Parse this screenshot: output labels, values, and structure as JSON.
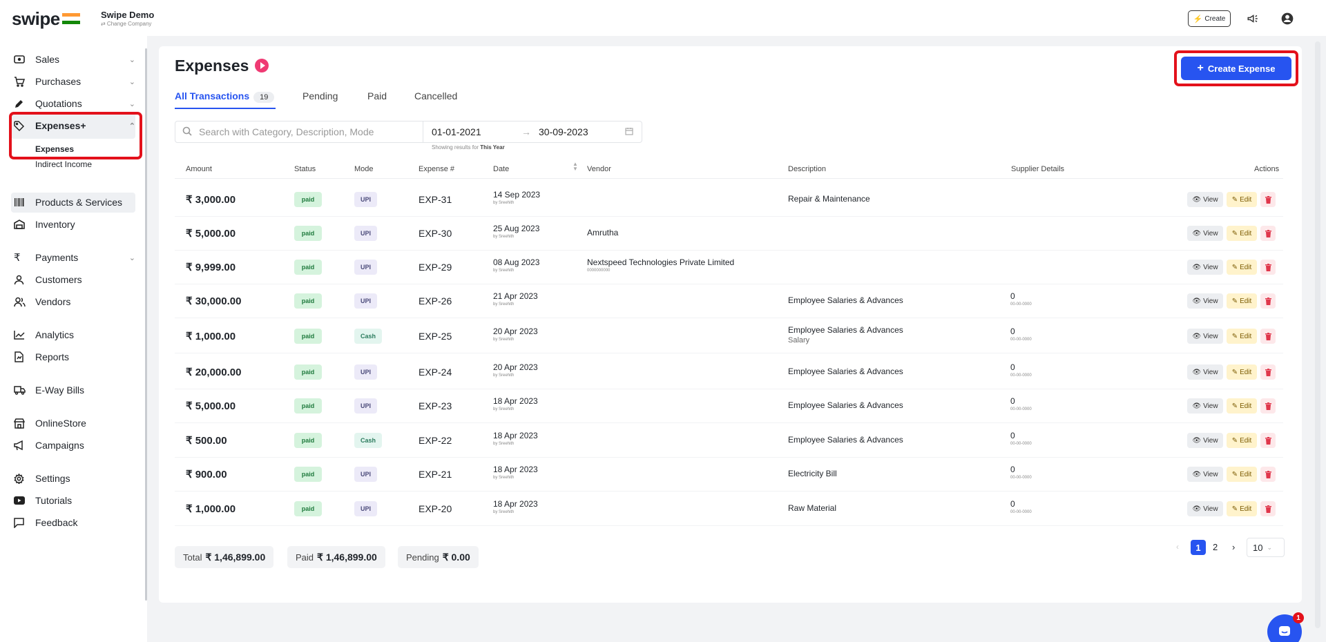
{
  "topbar": {
    "logo": "swipe",
    "company_name": "Swipe Demo",
    "change_company": "⇄ Change Company",
    "create_label": "Create"
  },
  "sidebar": {
    "items": [
      {
        "label": "Sales",
        "icon": "sales-icon",
        "chevron": true
      },
      {
        "label": "Purchases",
        "icon": "cart-icon",
        "chevron": true
      },
      {
        "label": "Quotations",
        "icon": "pencil-icon",
        "chevron": true
      },
      {
        "label": "Expenses+",
        "icon": "tag-icon",
        "chevron": true,
        "expanded": true
      },
      {
        "label": "Products & Services",
        "icon": "barcode-icon"
      },
      {
        "label": "Inventory",
        "icon": "warehouse-icon"
      },
      {
        "label": "Payments",
        "icon": "rupee-icon",
        "chevron": true
      },
      {
        "label": "Customers",
        "icon": "user-icon"
      },
      {
        "label": "Vendors",
        "icon": "users-icon"
      },
      {
        "label": "Analytics",
        "icon": "chart-icon"
      },
      {
        "label": "Reports",
        "icon": "report-icon"
      },
      {
        "label": "E-Way Bills",
        "icon": "truck-icon"
      },
      {
        "label": "OnlineStore",
        "icon": "store-icon"
      },
      {
        "label": "Campaigns",
        "icon": "megaphone-icon"
      },
      {
        "label": "Settings",
        "icon": "gear-icon"
      },
      {
        "label": "Tutorials",
        "icon": "youtube-icon"
      },
      {
        "label": "Feedback",
        "icon": "feedback-icon"
      }
    ],
    "sub_items": [
      "Expenses",
      "Indirect Income"
    ]
  },
  "page": {
    "title": "Expenses",
    "create_button": "Create Expense",
    "tabs": [
      {
        "label": "All Transactions",
        "count": "19",
        "active": true
      },
      {
        "label": "Pending"
      },
      {
        "label": "Paid"
      },
      {
        "label": "Cancelled"
      }
    ],
    "search_placeholder": "Search with Category, Description, Mode",
    "date_from": "01-01-2021",
    "date_to": "30-09-2023",
    "showing_prefix": "Showing results for",
    "showing_value": "This Year"
  },
  "table": {
    "headers": [
      "Amount",
      "Status",
      "Mode",
      "Expense #",
      "Date",
      "Vendor",
      "Description",
      "Supplier Details",
      "Actions"
    ],
    "rows": [
      {
        "amount": "₹ 3,000.00",
        "status": "paid",
        "mode": "UPI",
        "expense_no": "EXP-31",
        "date": "14 Sep 2023",
        "by": "by Sreehith",
        "vendor": "",
        "vendor_sub": "",
        "description": "Repair & Maintenance",
        "desc_sub": "",
        "supplier": "",
        "supplier_sub": ""
      },
      {
        "amount": "₹ 5,000.00",
        "status": "paid",
        "mode": "UPI",
        "expense_no": "EXP-30",
        "date": "25 Aug 2023",
        "by": "by Sreehith",
        "vendor": "Amrutha",
        "vendor_sub": "",
        "description": "",
        "desc_sub": "",
        "supplier": "",
        "supplier_sub": ""
      },
      {
        "amount": "₹ 9,999.00",
        "status": "paid",
        "mode": "UPI",
        "expense_no": "EXP-29",
        "date": "08 Aug 2023",
        "by": "by Sreehith",
        "vendor": "Nextspeed Technologies Private Limited",
        "vendor_sub": "0000000000",
        "description": "",
        "desc_sub": "",
        "supplier": "",
        "supplier_sub": ""
      },
      {
        "amount": "₹ 30,000.00",
        "status": "paid",
        "mode": "UPI",
        "expense_no": "EXP-26",
        "date": "21 Apr 2023",
        "by": "by Sreehith",
        "vendor": "",
        "vendor_sub": "",
        "description": "Employee Salaries & Advances",
        "desc_sub": "",
        "supplier": "0",
        "supplier_sub": "00-00-0000"
      },
      {
        "amount": "₹ 1,000.00",
        "status": "paid",
        "mode": "Cash",
        "expense_no": "EXP-25",
        "date": "20 Apr 2023",
        "by": "by Sreehith",
        "vendor": "",
        "vendor_sub": "",
        "description": "Employee Salaries & Advances",
        "desc_sub": "Salary",
        "supplier": "0",
        "supplier_sub": "00-00-0000"
      },
      {
        "amount": "₹ 20,000.00",
        "status": "paid",
        "mode": "UPI",
        "expense_no": "EXP-24",
        "date": "20 Apr 2023",
        "by": "by Sreehith",
        "vendor": "",
        "vendor_sub": "",
        "description": "Employee Salaries & Advances",
        "desc_sub": "",
        "supplier": "0",
        "supplier_sub": "00-00-0000"
      },
      {
        "amount": "₹ 5,000.00",
        "status": "paid",
        "mode": "UPI",
        "expense_no": "EXP-23",
        "date": "18 Apr 2023",
        "by": "by Sreehith",
        "vendor": "",
        "vendor_sub": "",
        "description": "Employee Salaries & Advances",
        "desc_sub": "",
        "supplier": "0",
        "supplier_sub": "00-00-0000"
      },
      {
        "amount": "₹ 500.00",
        "status": "paid",
        "mode": "Cash",
        "expense_no": "EXP-22",
        "date": "18 Apr 2023",
        "by": "by Sreehith",
        "vendor": "",
        "vendor_sub": "",
        "description": "Employee Salaries & Advances",
        "desc_sub": "",
        "supplier": "0",
        "supplier_sub": "00-00-0000"
      },
      {
        "amount": "₹ 900.00",
        "status": "paid",
        "mode": "UPI",
        "expense_no": "EXP-21",
        "date": "18 Apr 2023",
        "by": "by Sreehith",
        "vendor": "",
        "vendor_sub": "",
        "description": "Electricity Bill",
        "desc_sub": "",
        "supplier": "0",
        "supplier_sub": "00-00-0000"
      },
      {
        "amount": "₹ 1,000.00",
        "status": "paid",
        "mode": "UPI",
        "expense_no": "EXP-20",
        "date": "18 Apr 2023",
        "by": "by Sreehith",
        "vendor": "",
        "vendor_sub": "",
        "description": "Raw Material",
        "desc_sub": "",
        "supplier": "0",
        "supplier_sub": "00-00-0000"
      }
    ],
    "view_label": "View",
    "edit_label": "Edit"
  },
  "summary": {
    "total_label": "Total",
    "total_value": "₹ 1,46,899.00",
    "paid_label": "Paid",
    "paid_value": "₹ 1,46,899.00",
    "pending_label": "Pending",
    "pending_value": "₹ 0.00"
  },
  "pagination": {
    "pages": [
      "1",
      "2"
    ],
    "current": "1",
    "page_size": "10"
  },
  "chat_badge": "1",
  "colors": {
    "accent": "#2754f0",
    "highlight": "#e3111b",
    "paid_bg": "#d5f3dd"
  }
}
